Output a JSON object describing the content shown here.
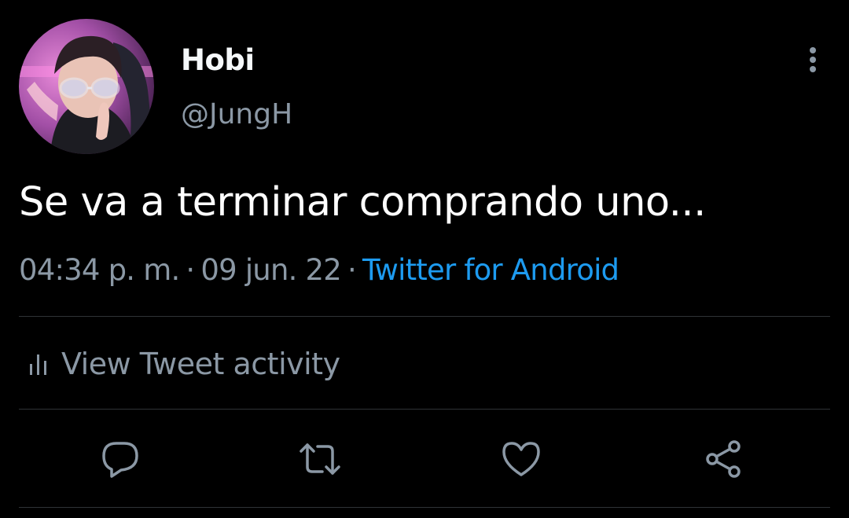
{
  "user": {
    "name": "Hobi",
    "handle": "@JungH"
  },
  "tweet": {
    "text": "Se va a terminar comprando uno...",
    "time": "04:34 p. m.",
    "date": "09 jun. 22",
    "separator": "·",
    "source": "Twitter for Android"
  },
  "activity": {
    "label": "View Tweet activity"
  },
  "actions": {
    "icons": [
      "reply-icon",
      "retweet-icon",
      "like-icon",
      "share-icon"
    ]
  },
  "colors": {
    "background": "#000000",
    "primary_text": "#ffffff",
    "secondary_text": "#8b98a5",
    "link": "#1d9bf0",
    "divider": "#2f3336"
  }
}
